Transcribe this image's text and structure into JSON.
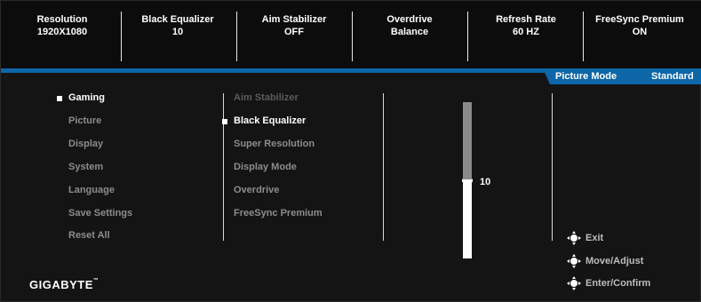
{
  "status_bar": {
    "items": [
      {
        "label": "Resolution",
        "value": "1920X1080"
      },
      {
        "label": "Black Equalizer",
        "value": "10"
      },
      {
        "label": "Aim Stabilizer",
        "value": "OFF"
      },
      {
        "label": "Overdrive",
        "value": "Balance"
      },
      {
        "label": "Refresh Rate",
        "value": "60 HZ"
      },
      {
        "label": "FreeSync Premium",
        "value": "ON"
      }
    ]
  },
  "picture_mode": {
    "label": "Picture Mode",
    "value": "Standard"
  },
  "main_menu": {
    "items": [
      "Gaming",
      "Picture",
      "Display",
      "System",
      "Language",
      "Save Settings",
      "Reset All"
    ],
    "selected": "Gaming"
  },
  "sub_menu": {
    "items": [
      "Aim Stabilizer",
      "Black Equalizer",
      "Super Resolution",
      "Display Mode",
      "Overdrive",
      "FreeSync Premium"
    ],
    "selected": "Black Equalizer",
    "disabled": "Aim Stabilizer"
  },
  "slider": {
    "value": "10",
    "min": 0,
    "max": 20
  },
  "help": {
    "exit": "Exit",
    "move_adjust": "Move/Adjust",
    "enter_confirm": "Enter/Confirm"
  },
  "brand": {
    "name": "GIGABYTE",
    "mark": "™"
  },
  "colors": {
    "accent": "#0d66a8",
    "background": "#141414",
    "text": "#ffffff",
    "inactive": "#8c8c8c"
  },
  "icons": {
    "help": "joystick-icon",
    "bullet": "square-bullet-icon"
  }
}
